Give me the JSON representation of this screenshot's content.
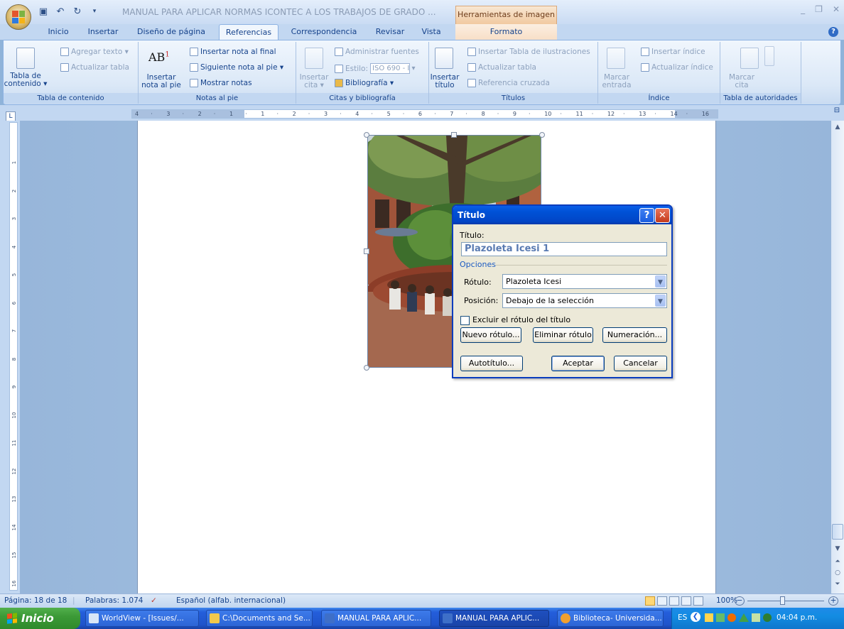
{
  "window": {
    "title": "MANUAL PARA APLICAR NORMAS ICONTEC A LOS TRABAJOS DE GRADO ...",
    "contextual_tab_group": "Herramientas de imagen"
  },
  "tabs": [
    "Inicio",
    "Insertar",
    "Diseño de página",
    "Referencias",
    "Correspondencia",
    "Revisar",
    "Vista",
    "Formato"
  ],
  "active_tab": "Referencias",
  "ribbon": {
    "groups": {
      "toc": {
        "label": "Tabla de contenido",
        "big_button": [
          "Tabla de",
          "contenido ▾"
        ],
        "items": [
          "Agregar texto ▾",
          "Actualizar tabla"
        ]
      },
      "footnotes": {
        "label": "Notas al pie",
        "big_button": [
          "Insertar",
          "nota al pie"
        ],
        "items": [
          "Insertar nota al final",
          "Siguiente nota al pie ▾",
          "Mostrar notas"
        ]
      },
      "citations": {
        "label": "Citas y bibliografía",
        "big_button": [
          "Insertar",
          "cita ▾"
        ],
        "items": [
          "Administrar fuentes",
          "Estilo:",
          "Bibliografía ▾"
        ],
        "style_value": "ISO 690 - I ▾"
      },
      "captions": {
        "label": "Títulos",
        "big_button": [
          "Insertar",
          "título"
        ],
        "items": [
          "Insertar Tabla de ilustraciones",
          "Actualizar tabla",
          "Referencia cruzada"
        ]
      },
      "index": {
        "label": "Índice",
        "big_button": [
          "Marcar",
          "entrada"
        ],
        "items": [
          "Insertar índice",
          "Actualizar índice"
        ]
      },
      "authorities": {
        "label": "Tabla de autoridades",
        "big_button": [
          "Marcar",
          "cita"
        ]
      }
    }
  },
  "ruler": {
    "ticks": [
      "4",
      "·",
      "3",
      "·",
      "2",
      "·",
      "1",
      "·",
      "1",
      "·",
      "2",
      "·",
      "3",
      "·",
      "4",
      "·",
      "5",
      "·",
      "6",
      "·",
      "7",
      "·",
      "8",
      "·",
      "9",
      "·",
      "10",
      "·",
      "11",
      "·",
      "12",
      "·",
      "13",
      "·",
      "14",
      "·",
      "16"
    ],
    "left_ruler_ticks": [
      "1",
      "2",
      "3",
      "4",
      "5",
      "6",
      "7",
      "8",
      "9",
      "10",
      "11",
      "12",
      "13",
      "14",
      "15",
      "16"
    ]
  },
  "dialog": {
    "title": "Título",
    "help_glyph": "?",
    "close_glyph": "✕",
    "caption_label": "Título:",
    "caption_value": "Plazoleta Icesi 1",
    "options_label": "Opciones",
    "label_label": "Rótulo:",
    "label_value": "Plazoleta Icesi",
    "position_label": "Posición:",
    "position_value": "Debajo de la selección",
    "exclude_label": "Excluir el rótulo del título",
    "exclude_checked": false,
    "buttons": {
      "new_label": "Nuevo rótulo...",
      "delete_label": "Eliminar rótulo",
      "numbering": "Numeración...",
      "autocaption": "Autotítulo...",
      "ok": "Aceptar",
      "cancel": "Cancelar"
    }
  },
  "statusbar": {
    "page": "Página: 18 de 18",
    "words": "Palabras: 1.074",
    "language": "Español (alfab. internacional)",
    "zoom": "100%"
  },
  "taskbar": {
    "start": "Inicio",
    "buttons": [
      "WorldView - [Issues/...",
      "C:\\Documents and Se...",
      "MANUAL PARA APLIC...",
      "MANUAL PARA APLIC...",
      "Biblioteca- Universida..."
    ],
    "active_index": 3,
    "tray_lang": "ES",
    "clock": "04:04 p.m."
  },
  "colors": {
    "ribbon_text": "#15428b",
    "dialog_title": "#0052d7",
    "caption_text": "#5a7bb2",
    "taskbar": "#245edb",
    "start": "#3c9a37"
  }
}
